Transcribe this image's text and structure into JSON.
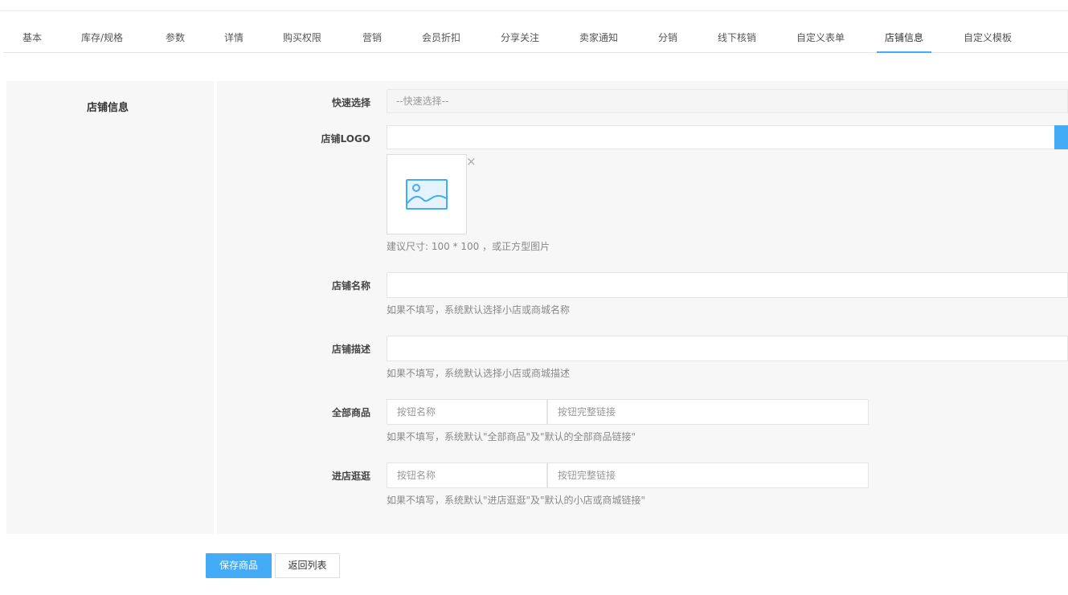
{
  "tabs": [
    {
      "label": "基本"
    },
    {
      "label": "库存/规格"
    },
    {
      "label": "参数"
    },
    {
      "label": "详情"
    },
    {
      "label": "购买权限"
    },
    {
      "label": "营销"
    },
    {
      "label": "会员折扣"
    },
    {
      "label": "分享关注"
    },
    {
      "label": "卖家通知"
    },
    {
      "label": "分销"
    },
    {
      "label": "线下核销"
    },
    {
      "label": "自定义表单"
    },
    {
      "label": "店铺信息"
    },
    {
      "label": "自定义模板"
    }
  ],
  "active_tab": "店铺信息",
  "sidebar": {
    "title": "店铺信息"
  },
  "form": {
    "quick_select": {
      "label": "快速选择",
      "value": "--快速选择--"
    },
    "logo": {
      "label": "店铺LOGO",
      "value": "",
      "hint": "建议尺寸: 100 * 100 ，或正方型图片",
      "remove": "×"
    },
    "shop_name": {
      "label": "店铺名称",
      "value": "",
      "hint": "如果不填写，系统默认选择小店或商城名称"
    },
    "shop_desc": {
      "label": "店铺描述",
      "value": "",
      "hint": "如果不填写，系统默认选择小店或商城描述"
    },
    "all_goods": {
      "label": "全部商品",
      "name_placeholder": "按钮名称",
      "link_placeholder": "按钮完整链接",
      "hint": "如果不填写，系统默认\"全部商品\"及\"默认的全部商品链接\""
    },
    "visit_shop": {
      "label": "进店逛逛",
      "name_placeholder": "按钮名称",
      "link_placeholder": "按钮完整链接",
      "hint": "如果不填写，系统默认\"进店逛逛\"及\"默认的小店或商城链接\""
    }
  },
  "actions": {
    "save": "保存商品",
    "back": "返回列表"
  },
  "colors": {
    "accent": "#44abf7",
    "panel": "#f7f7f7"
  }
}
